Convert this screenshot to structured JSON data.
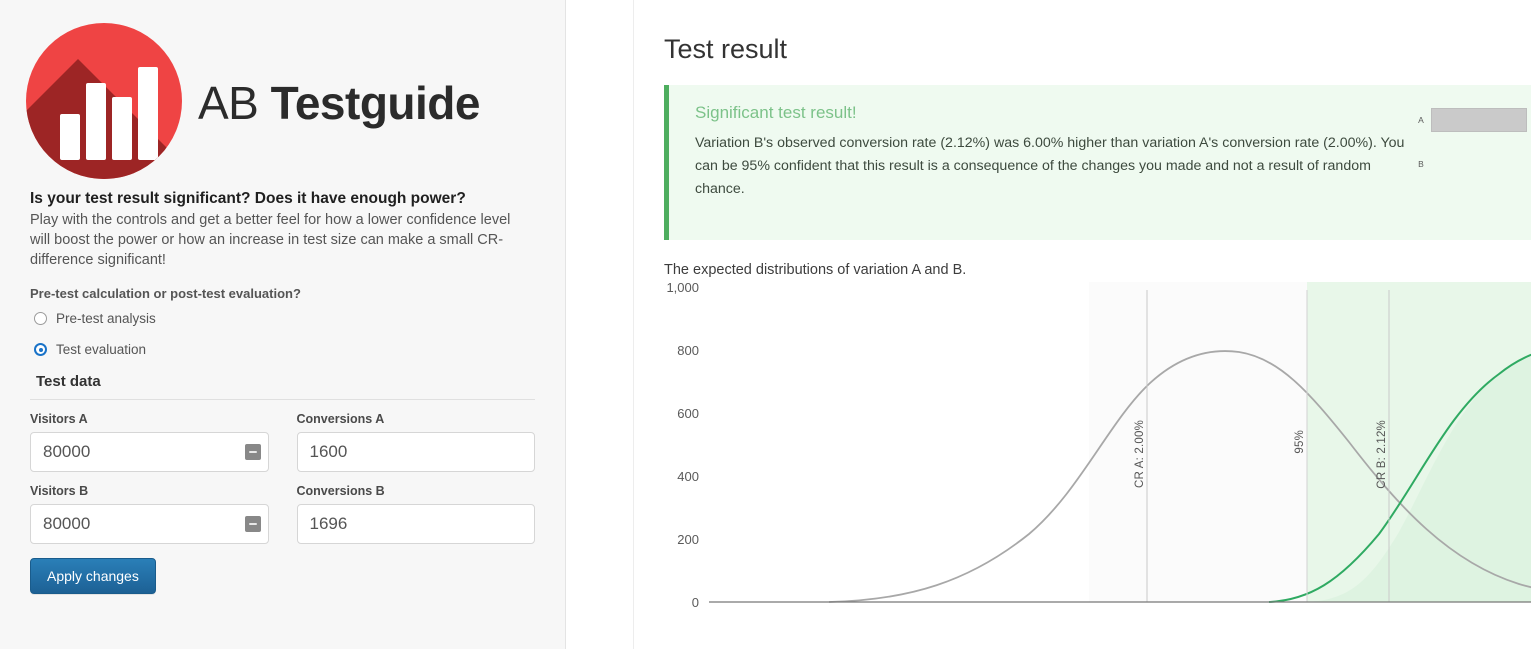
{
  "brand": {
    "name_light": "AB",
    "name_bold": "Testguide",
    "logo_icon": "bar-chart-logo-icon"
  },
  "sidebar": {
    "tagline": "Is your test result significant? Does it have enough power?",
    "intro": "Play with the controls and get a better feel for how a lower confidence level will boost the power or how an increase in test size can make a small CR-difference significant!",
    "mode_question": "Pre-test calculation or post-test evaluation?",
    "modes": [
      {
        "label": "Pre-test analysis",
        "selected": false
      },
      {
        "label": "Test evaluation",
        "selected": true
      }
    ],
    "test_data_title": "Test data",
    "fields": [
      {
        "label": "Visitors A",
        "value": "80000",
        "stepper": true
      },
      {
        "label": "Conversions A",
        "value": "1600",
        "stepper": false
      },
      {
        "label": "Visitors B",
        "value": "80000",
        "stepper": true
      },
      {
        "label": "Conversions B",
        "value": "1696",
        "stepper": false
      }
    ],
    "apply_label": "Apply changes"
  },
  "result": {
    "page_title": "Test result",
    "alert_title": "Significant test result!",
    "alert_body": "Variation B's observed conversion rate (2.12%) was 6.00% higher than variation A's conversion rate (2.00%). You can be 95% confident that this result is a consequence of the changes you made and not a result of random chance.",
    "mini_bars": [
      {
        "label": "A"
      },
      {
        "label": "B"
      }
    ],
    "accent_green": "#4eae5f",
    "alert_bg": "#effaf0",
    "title_green": "#7cc289"
  },
  "chart_data": {
    "type": "line",
    "title": "The expected distributions of variation A and B.",
    "xlabel": "",
    "ylabel": "",
    "ylim": [
      0,
      1000
    ],
    "yticks": [
      0,
      200,
      400,
      600,
      800,
      1000
    ],
    "ytick_labels": [
      "0",
      "200",
      "400",
      "600",
      "800",
      "1,000"
    ],
    "grid": false,
    "legend": "none",
    "series": [
      {
        "name": "Variation A",
        "color": "#9a9a9a",
        "peak_value": 800,
        "peak_label": "CR A: 2.00%",
        "mean_pct": 2.0,
        "filled": false
      },
      {
        "name": "Variation B",
        "color": "#2faa62",
        "peak_value": 760,
        "peak_label": "CR B: 2.12%",
        "mean_pct": 2.12,
        "filled": true,
        "fill_color": "#e8f7e9"
      }
    ],
    "annotations": [
      {
        "label": "CR A: 2.00%",
        "type": "vline"
      },
      {
        "label": "95%",
        "type": "vline"
      },
      {
        "label": "CR B: 2.12%",
        "type": "vline"
      }
    ],
    "confidence_label": "95%"
  }
}
